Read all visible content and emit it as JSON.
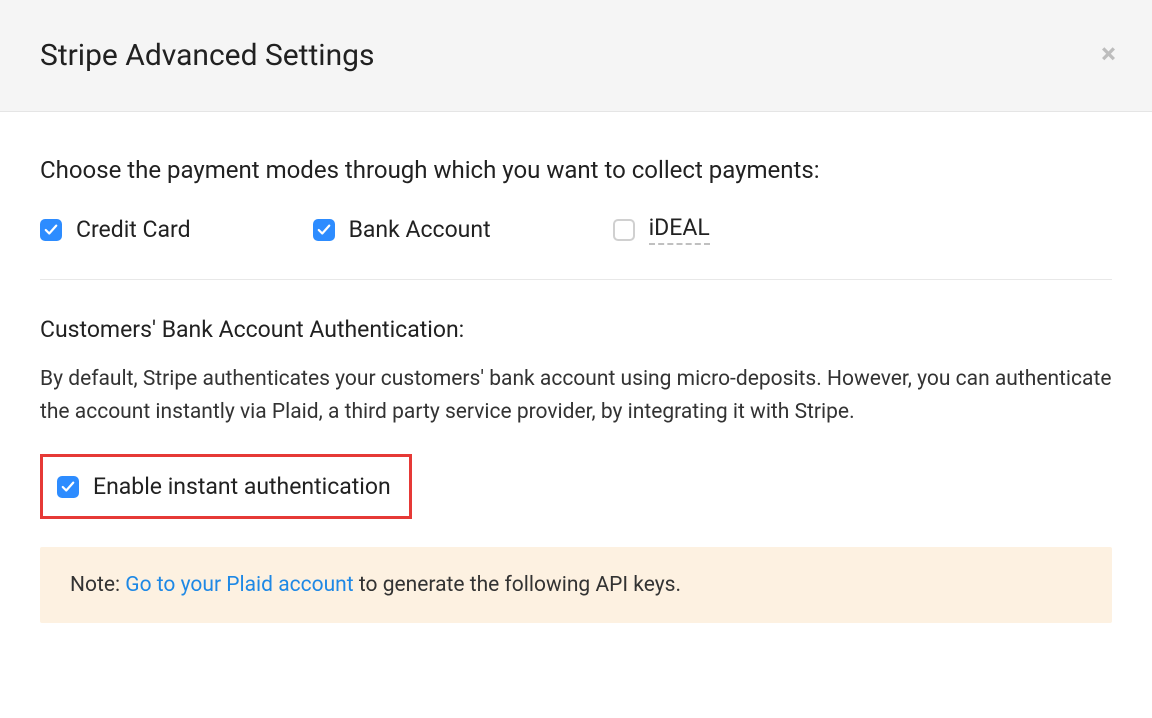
{
  "header": {
    "title": "Stripe Advanced Settings"
  },
  "payment_modes": {
    "heading": "Choose the payment modes through which you want to collect payments:",
    "options": {
      "credit_card": "Credit Card",
      "bank_account": "Bank Account",
      "ideal": "iDEAL"
    }
  },
  "bank_auth": {
    "heading": "Customers' Bank Account Authentication:",
    "description": "By default, Stripe authenticates your customers' bank account using micro-deposits. However, you can authenticate the account instantly via Plaid, a third party service provider, by integrating it with Stripe.",
    "enable_label": "Enable instant authentication"
  },
  "note": {
    "prefix": "Note: ",
    "link_text": "Go to your Plaid account",
    "suffix": " to generate the following API keys."
  }
}
